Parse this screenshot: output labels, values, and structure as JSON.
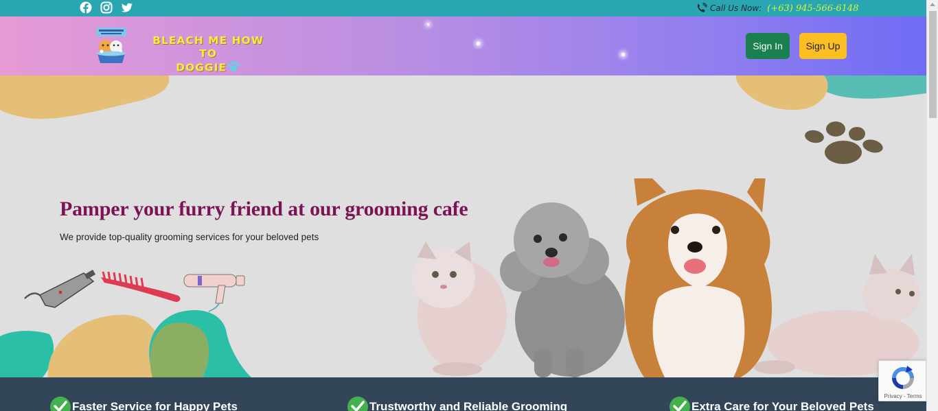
{
  "topbar": {
    "social_icons": [
      "facebook-icon",
      "instagram-icon",
      "twitter-icon"
    ],
    "call_label": "Call Us Now:",
    "call_number": "(+63) 945-566-6148",
    "call_icon": "phone-icon",
    "colors": {
      "background": "#2aa6b2",
      "number": "#d6f33a"
    }
  },
  "header": {
    "brand_line1": "BLEACH ME HOW TO",
    "brand_line2": "DOGGIE",
    "brand_icon": "paw-icon",
    "signin_label": "Sign In",
    "signup_label": "Sign Up",
    "colors": {
      "gradient_start": "#e79ad6",
      "gradient_end": "#6f6cf4",
      "signin": "#1a8050",
      "signup": "#fbbf24",
      "brand_text": "#f7ea48"
    }
  },
  "hero": {
    "title": "Pamper your furry friend at our grooming cafe",
    "subtitle": "We provide top-quality grooming services for your beloved pets",
    "colors": {
      "background": "#dfdfdf",
      "title": "#7b1455"
    }
  },
  "features": {
    "items": [
      {
        "label": "Faster Service for Happy Pets"
      },
      {
        "label": "Trustworthy and Reliable Grooming"
      },
      {
        "label": "Extra Care for Your Beloved Pets"
      }
    ],
    "colors": {
      "background": "#334558",
      "check": "#44b14f"
    }
  },
  "recaptcha": {
    "privacy": "Privacy",
    "separator": " - ",
    "terms": "Terms"
  }
}
